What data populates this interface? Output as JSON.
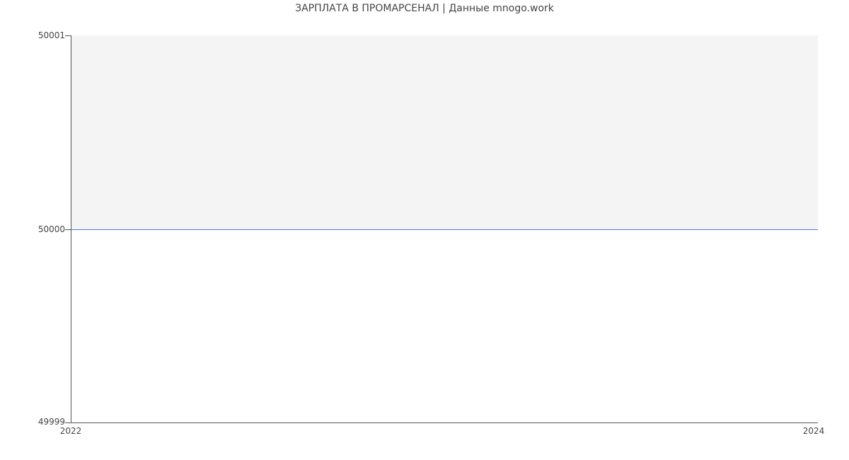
{
  "chart_data": {
    "type": "line",
    "title": "ЗАРПЛАТА В ПРОМАРСЕНАЛ | Данные mnogo.work",
    "xlabel": "",
    "ylabel": "",
    "x": [
      2022,
      2024
    ],
    "y": [
      50000,
      50000
    ],
    "xlim": [
      2022,
      2024
    ],
    "ylim": [
      49999,
      50001
    ],
    "x_ticks": [
      "2022",
      "2024"
    ],
    "y_ticks": [
      "49999",
      "50000",
      "50001"
    ],
    "line_color": "#4a7fe8"
  }
}
